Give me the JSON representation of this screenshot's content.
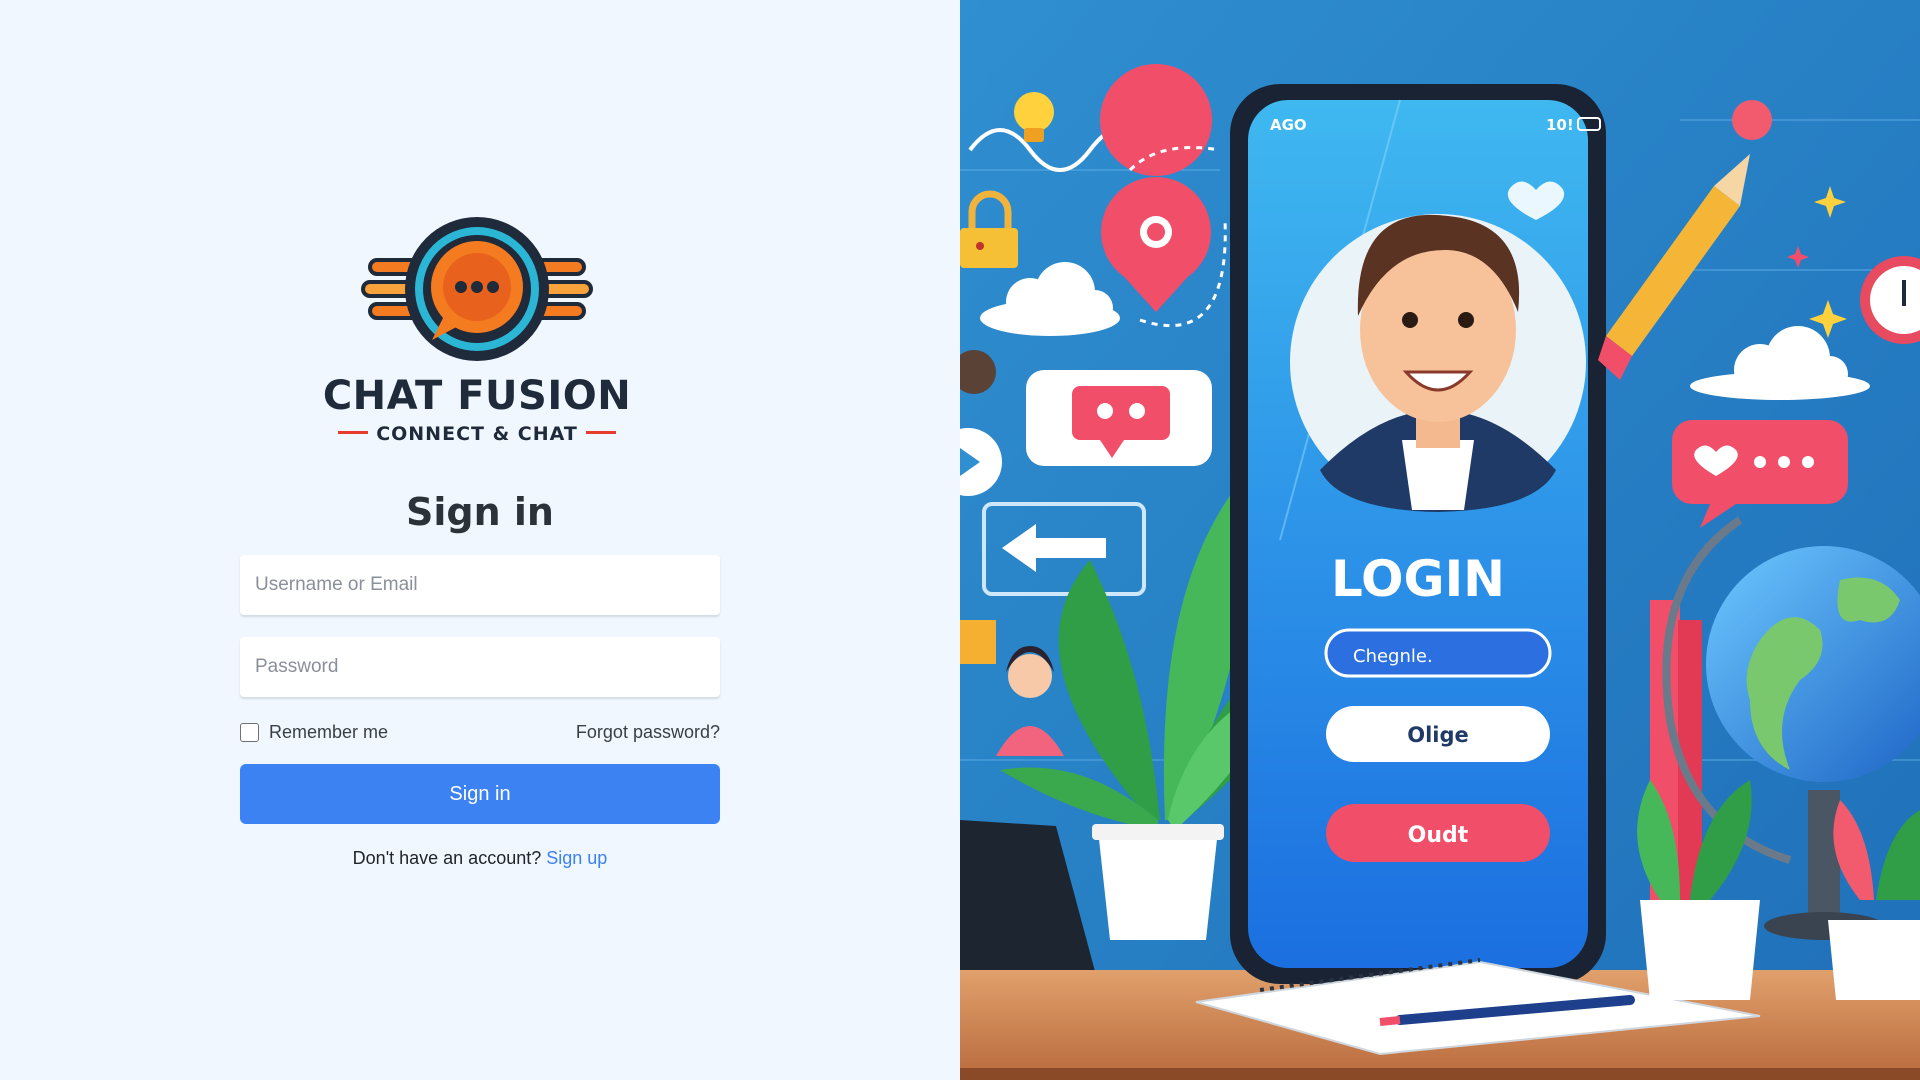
{
  "brand": {
    "name": "CHAT FUSION",
    "tagline": "CONNECT & CHAT",
    "colors": {
      "orange": "#f47b20",
      "dark": "#1f2a3a",
      "red": "#e63b2e",
      "teal": "#2bb6d6"
    }
  },
  "form": {
    "title": "Sign in",
    "username_placeholder": "Username or Email",
    "password_placeholder": "Password",
    "remember_label": "Remember me",
    "remember_checked": false,
    "forgot_label": "Forgot password?",
    "submit_label": "Sign in",
    "signup_prompt": "Don't have an account?",
    "signup_link": "Sign up",
    "accent_color": "#3d82f2"
  },
  "illustration": {
    "phone_status_left": "AGO",
    "phone_status_right": "10!",
    "login_heading": "LOGIN",
    "field_text": "Chegnle.",
    "button_primary": "Olige",
    "button_secondary": "Oudt",
    "icons": [
      "lightbulb-icon",
      "padlock-icon",
      "location-pin-icon",
      "chat-bubble-icon",
      "heart-chat-icon",
      "arrow-left-icon",
      "pencil-icon",
      "globe-icon",
      "alarm-clock-icon",
      "cloud-icon",
      "plant-icon",
      "laptop-icon",
      "notebook-icon"
    ]
  }
}
